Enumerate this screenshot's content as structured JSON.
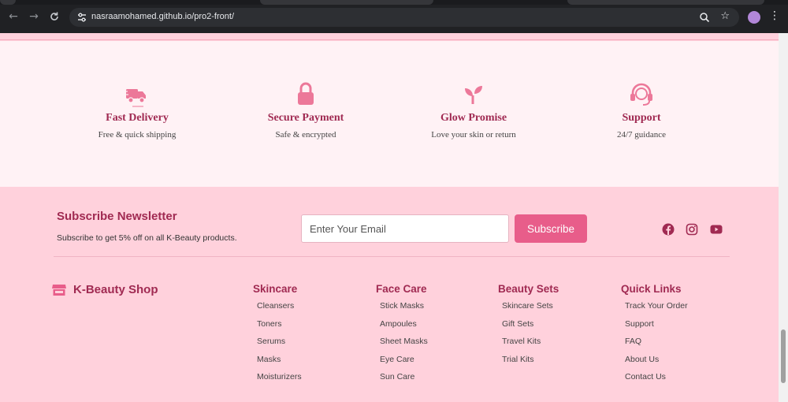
{
  "browser": {
    "url": "nasraamohamed.github.io/pro2-front/",
    "icons": [
      "back-icon",
      "forward-icon",
      "reload-icon",
      "site-settings-icon",
      "zoom-icon",
      "star-icon",
      "profile-icon",
      "menu-icon"
    ]
  },
  "features": [
    {
      "icon": "truck-icon",
      "title": "Fast Delivery",
      "text": "Free & quick shipping"
    },
    {
      "icon": "lock-icon",
      "title": "Secure Payment",
      "text": "Safe & encrypted"
    },
    {
      "icon": "seedling-icon",
      "title": "Glow Promise",
      "text": "Love your skin or return"
    },
    {
      "icon": "headset-icon",
      "title": "Support",
      "text": "24/7 guidance"
    }
  ],
  "newsletter": {
    "title": "Subscribe Newsletter",
    "subtitle": "Subscribe to get 5% off on all K-Beauty products.",
    "email_placeholder": "Enter Your Email",
    "button": "Subscribe",
    "social": [
      "facebook-icon",
      "instagram-icon",
      "youtube-icon"
    ]
  },
  "footer": {
    "brand": "K-Beauty Shop",
    "columns": [
      {
        "title": "Skincare",
        "items": [
          "Cleansers",
          "Toners",
          "Serums",
          "Masks",
          "Moisturizers"
        ]
      },
      {
        "title": "Face Care",
        "items": [
          "Stick Masks",
          "Ampoules",
          "Sheet Masks",
          "Eye Care",
          "Sun Care"
        ]
      },
      {
        "title": "Beauty Sets",
        "items": [
          "Skincare Sets",
          "Gift Sets",
          "Travel Kits",
          "Trial Kits"
        ]
      },
      {
        "title": "Quick Links",
        "items": [
          "Track Your Order",
          "Support",
          "FAQ",
          "About Us",
          "Contact Us"
        ]
      }
    ]
  },
  "colors": {
    "accent": "#e85d8a",
    "heading": "#a02a52",
    "icon": "#ec7899",
    "page_bg": "#ffd1dc",
    "feature_bg": "#fff2f5"
  }
}
